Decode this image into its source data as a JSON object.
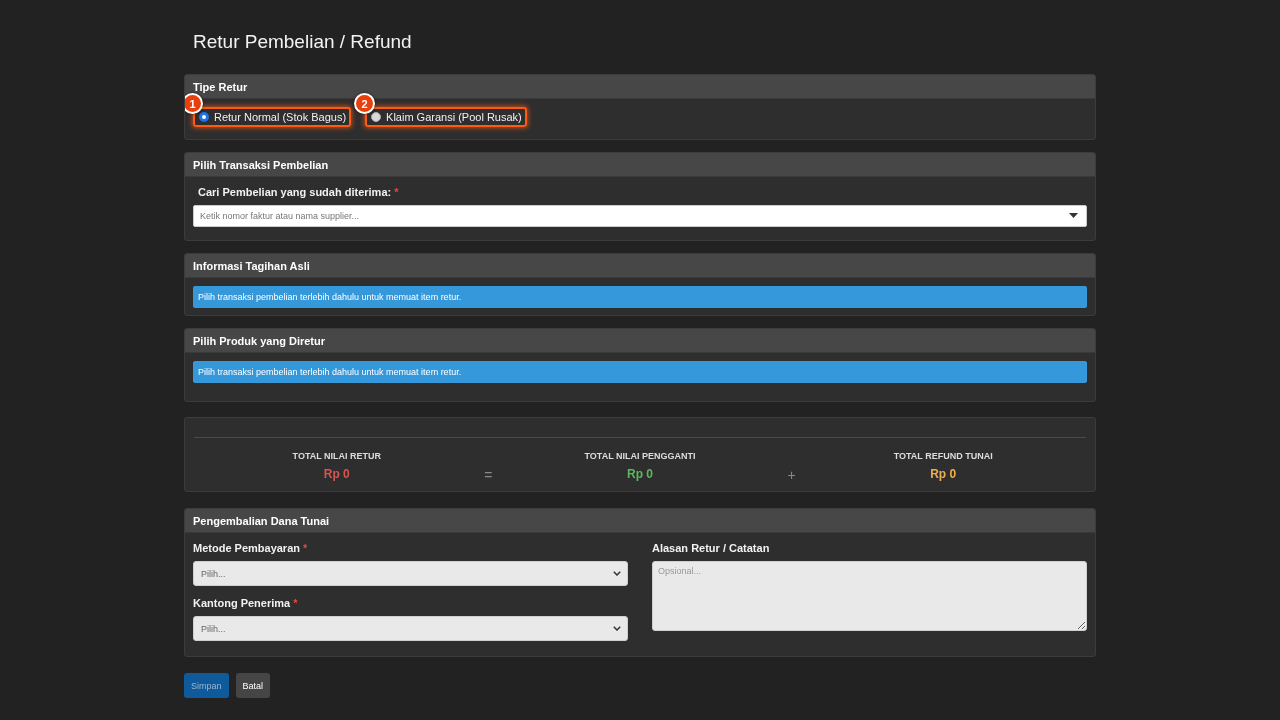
{
  "page": {
    "title": "Retur Pembelian / Refund"
  },
  "return_type": {
    "title": "Tipe Retur",
    "options": [
      {
        "label": "Retur Normal (Stok Bagus)",
        "selected": true,
        "highlighted": true,
        "marker": "1"
      },
      {
        "label": "Klaim Garansi (Pool Rusak)",
        "selected": false,
        "highlighted": true,
        "marker": "2"
      }
    ]
  },
  "purchase_select": {
    "title": "Pilih Transaksi Pembelian",
    "label": "Cari Pembelian yang sudah diterima:",
    "required_mark": "*",
    "placeholder": "Ketik nomor faktur atau nama supplier..."
  },
  "original_invoice": {
    "title": "Informasi Tagihan Asli",
    "alert": "Pilih transaksi pembelian terlebih dahulu untuk memuat item retur."
  },
  "return_products": {
    "title": "Pilih Produk yang Diretur",
    "alert": "Pilih transaksi pembelian terlebih dahulu untuk memuat item retur."
  },
  "totals": {
    "items": [
      {
        "kind": "stat",
        "label": "TOTAL NILAI RETUR",
        "value": "Rp 0",
        "color": "#d9534f"
      },
      {
        "kind": "operator",
        "symbol": "="
      },
      {
        "kind": "stat",
        "label": "TOTAL NILAI PENGGANTI",
        "value": "Rp 0",
        "color": "#5cb85c"
      },
      {
        "kind": "operator",
        "symbol": "+"
      },
      {
        "kind": "stat",
        "label": "TOTAL REFUND TUNAI",
        "value": "Rp 0",
        "color": "#f0ad4e"
      }
    ]
  },
  "cash_refund": {
    "title": "Pengembalian Dana Tunai",
    "selects": [
      {
        "label": "Metode Pembayaran",
        "required_mark": "*",
        "value": "Pilih..."
      },
      {
        "label": "Kantong Penerima",
        "required_mark": "*",
        "value": "Pilih..."
      }
    ],
    "notes": {
      "label": "Alasan Retur / Catatan",
      "placeholder": "Opsional..."
    }
  },
  "buttons": [
    {
      "label": "Simpan",
      "kind": "primary",
      "disabled": true
    },
    {
      "label": "Batal",
      "kind": "secondary",
      "disabled": false
    }
  ]
}
